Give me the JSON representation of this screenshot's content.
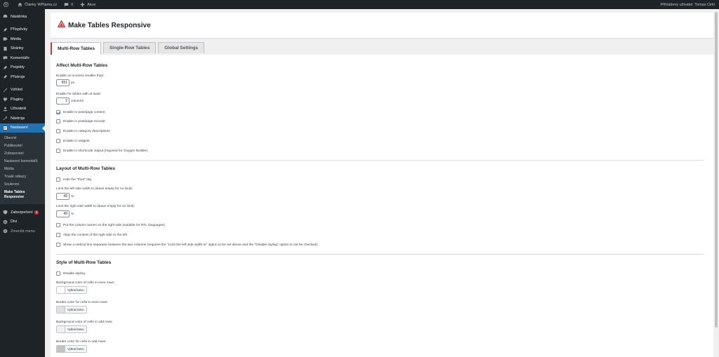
{
  "adminbar": {
    "site_name": "Články WPlama.cz",
    "comments_count": "0",
    "new_label": "Akce",
    "greeting": "Přihlášený uživatel: Tomas Cirkl"
  },
  "sidebar": {
    "items": [
      {
        "label": "Nástěnka",
        "icon": "dashboard-icon"
      },
      {
        "label": "Příspěvky",
        "icon": "pin-icon"
      },
      {
        "label": "Média",
        "icon": "media-icon"
      },
      {
        "label": "Stránky",
        "icon": "page-icon"
      },
      {
        "label": "Komentáře",
        "icon": "comment-icon"
      },
      {
        "label": "Projekty",
        "icon": "pin-icon"
      },
      {
        "label": "Přístroje",
        "icon": "pin-icon"
      },
      {
        "label": "Vzhled",
        "icon": "brush-icon"
      },
      {
        "label": "Pluginy",
        "icon": "plugin-icon"
      },
      {
        "label": "Uživatelé",
        "icon": "user-icon"
      },
      {
        "label": "Nástroje",
        "icon": "wrench-icon"
      },
      {
        "label": "Nastavení",
        "icon": "settings-icon"
      }
    ],
    "submenu": [
      "Obecné",
      "Publikování",
      "Zobrazování",
      "Nastavení komentářů",
      "Média",
      "Trvalé odkazy",
      "Soukromí",
      "Make Tables Responsive"
    ],
    "after": [
      {
        "label": "Zabezpečení",
        "badge": "1",
        "icon": "shield-icon"
      },
      {
        "label": "Divi",
        "icon": "divi-icon"
      },
      {
        "label": "Zmenšit menu",
        "icon": "collapse-icon"
      }
    ]
  },
  "header": {
    "title": "Make Tables Responsive",
    "accent": "#d63638"
  },
  "tabs": [
    "Multi-Row Tables",
    "Single-Row Tables",
    "Global Settings"
  ],
  "affect": {
    "title": "Affect Multi-Row Tables",
    "screens_label": "Enable on screens smaller than:",
    "screens_value": "651",
    "screens_unit": "px",
    "columns_label": "Enable for tables with at least:",
    "columns_value": "2",
    "columns_unit": "columns",
    "checks": [
      {
        "label": "Enable in post/page content",
        "checked": true
      },
      {
        "label": "Enable in post/page excerpt",
        "checked": false
      },
      {
        "label": "Enable in category descriptions",
        "checked": false
      },
      {
        "label": "Enable in widgets",
        "checked": false
      },
      {
        "label": "Enable in shortcode output (required for Oxygen Builder)",
        "checked": false
      }
    ]
  },
  "layout": {
    "title": "Layout of Multi-Row Tables",
    "hide_tfoot": "Hide the \"tfoot\" tag",
    "left_label": "Limit the left side width to (leave empty for no limit):",
    "left_value": "49",
    "left_unit": "%",
    "right_label": "Limit the right side width to (leave empty for no limit):",
    "right_value": "49",
    "right_unit": "%",
    "checks": [
      {
        "label": "Put the column names on the right side (suitable for RTL languages)",
        "checked": false
      },
      {
        "label": "Align the content of the right side to the left",
        "checked": false
      },
      {
        "label": "Show a vertical line separator between the two columns (requires the \"Limit the left side width to\" option to be set above and the \"Disable styling\" option to not be checked)",
        "checked": false
      }
    ]
  },
  "style": {
    "title": "Style of Multi-Row Tables",
    "disable_styling": "Disable styling",
    "colors": [
      {
        "label": "Background color of cells in even rows:",
        "button": "Vybrat barvu",
        "color": "#ffffff"
      },
      {
        "label": "Border color for cells in even rows:",
        "button": "Vybrat barvu",
        "color": "#e0e0e0"
      },
      {
        "label": "Background color of cells in odd rows:",
        "button": "Vybrat barvu",
        "color": "#f0f0f0"
      },
      {
        "label": "Border color for cells in odd rows:",
        "button": "Vybrat barvu",
        "color": "#c4c4c4"
      }
    ]
  }
}
